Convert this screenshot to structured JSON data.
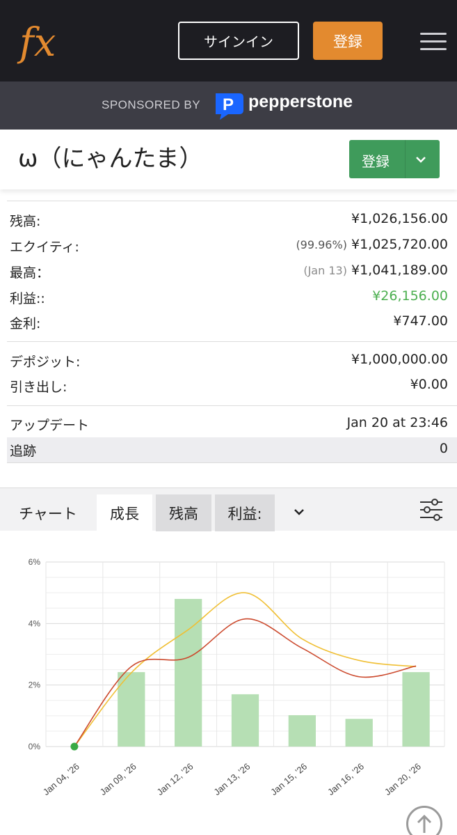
{
  "header": {
    "logo_text": "fx",
    "signin_label": "サインイン",
    "register_label": "登録"
  },
  "sponsor": {
    "label": "SPONSORED BY",
    "brand": "pepperstone"
  },
  "account": {
    "title": "ω（にゃんたま）",
    "follow_label": "登録"
  },
  "stats": {
    "balance": {
      "label": "残高:",
      "value": "¥1,026,156.00"
    },
    "equity": {
      "label": "エクイティ:",
      "note": "(99.96%)",
      "value": "¥1,025,720.00"
    },
    "highest": {
      "label": "最高：",
      "note": "(Jan 13)",
      "value": "¥1,041,189.00"
    },
    "profit": {
      "label": "利益::",
      "value": "¥26,156.00"
    },
    "interest": {
      "label": "金利:",
      "value": "¥747.00"
    },
    "deposits": {
      "label": "デポジット:",
      "value": "¥1,000,000.00"
    },
    "withdrawals": {
      "label": "引き出し:",
      "value": "¥0.00"
    },
    "updated": {
      "label": "アップデート",
      "value": "Jan 20 at 23:46"
    },
    "tracking": {
      "label": "追跡",
      "value": "0"
    }
  },
  "tabs": {
    "chart": "チャート",
    "growth": "成長",
    "balance": "残高",
    "profit": "利益:"
  },
  "colors": {
    "bar": "#b6dfb4",
    "line_red": "#cc4a2e",
    "line_yellow": "#f0bf33",
    "dot": "#3aaa45",
    "profit_green": "#4caf50",
    "register_orange": "#e38a2f",
    "follow_green": "#3f9b5b"
  },
  "chart_data": {
    "type": "bar",
    "categories": [
      "Jan 04, '26",
      "Jan 09, '26",
      "Jan 12, '26",
      "Jan 13, '26",
      "Jan 15, '26",
      "Jan 16, '26",
      "Jan 20, '26"
    ],
    "y_ticks": [
      "6%",
      "4%",
      "2%",
      "0%"
    ],
    "ylim": [
      0,
      6
    ],
    "bars": [
      0,
      2.42,
      4.8,
      1.7,
      1.02,
      0.9,
      2.42
    ],
    "series": [
      {
        "values": [
          0,
          2.6,
          2.9,
          4.15,
          3.2,
          2.27,
          2.62
        ]
      },
      {
        "values": [
          0,
          2.4,
          3.8,
          5.0,
          3.5,
          2.8,
          2.6
        ]
      }
    ],
    "grid": true
  }
}
